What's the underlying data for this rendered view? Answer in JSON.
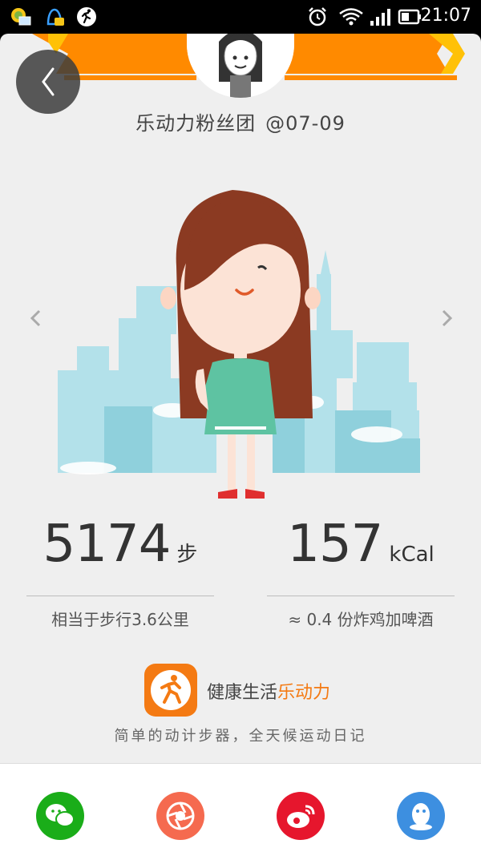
{
  "status_bar": {
    "time": "21:07",
    "icons": [
      "weather-mail-icon",
      "chat-notification-icon",
      "running-app-icon",
      "alarm-icon",
      "wifi-icon",
      "signal-icon",
      "battery-icon"
    ]
  },
  "header": {
    "group_name": "乐动力粉丝团",
    "date": "@07-09"
  },
  "stats": {
    "steps": {
      "value": "5174",
      "unit": "步",
      "equivalent": "相当于步行3.6公里"
    },
    "calories": {
      "value": "157",
      "unit": "kCal",
      "equivalent": "≈ 0.4 份炸鸡加啤酒"
    }
  },
  "brand": {
    "prefix": "健康生活",
    "name": "乐动力",
    "slogan": "简单的动计步器，全天候运动日记"
  },
  "share_bar": [
    {
      "name": "wechat",
      "color": "#1aad19"
    },
    {
      "name": "moments",
      "color": "#f56a4f"
    },
    {
      "name": "weibo",
      "color": "#e6162d"
    },
    {
      "name": "qq",
      "color": "#3d8fe0"
    }
  ],
  "colors": {
    "ribbon": "#ff8a00",
    "ribbon_dark": "#ffc107",
    "accent": "#f47a13",
    "card_bg": "#efefef"
  }
}
